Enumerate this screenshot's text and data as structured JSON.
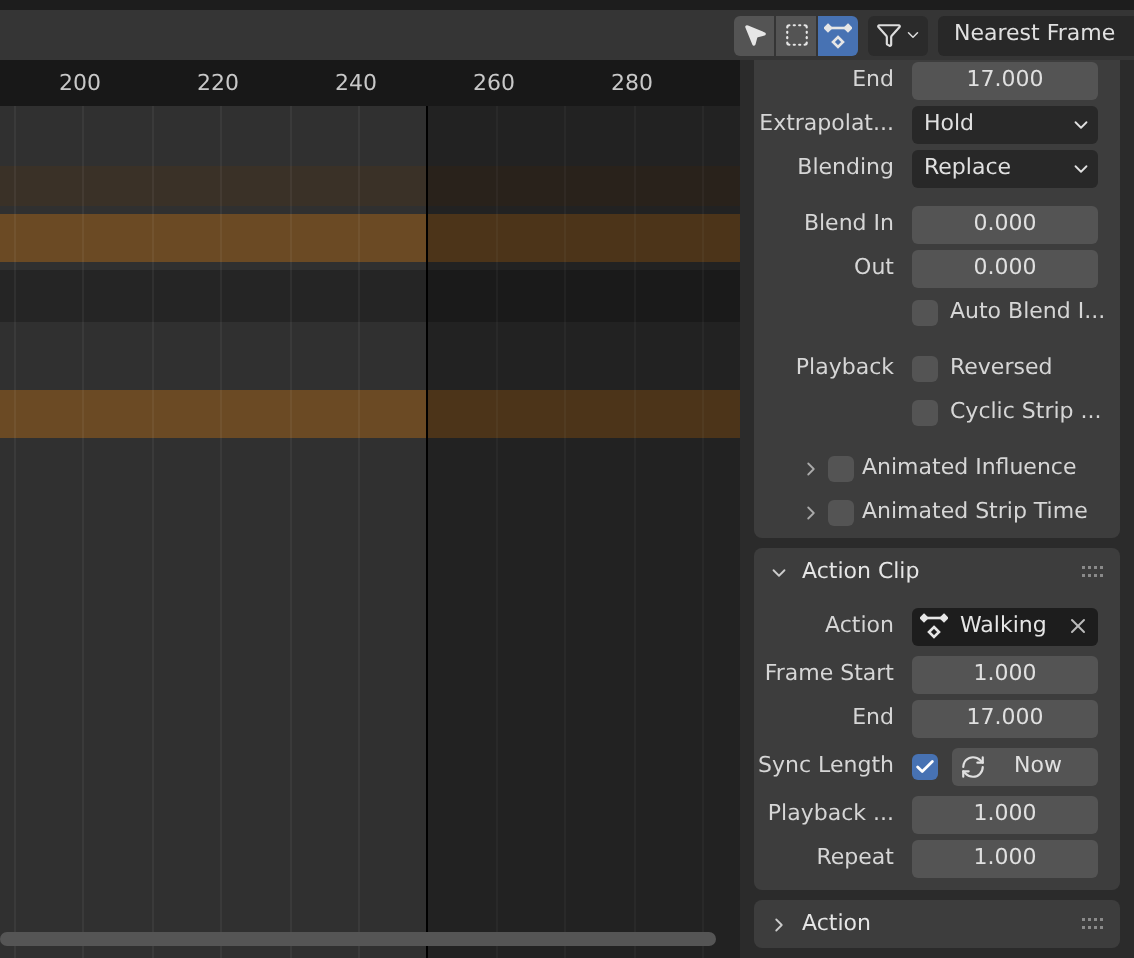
{
  "header": {
    "tools": [
      {
        "kind": "select",
        "selected": false
      },
      {
        "kind": "box",
        "selected": false
      },
      {
        "kind": "keyframe",
        "selected": true
      }
    ],
    "snap": "Nearest Frame"
  },
  "timeline": {
    "ruler": [
      "200",
      "220",
      "240",
      "260",
      "280"
    ],
    "tracks": [
      {
        "kind": "empty"
      },
      {
        "kind": "highlight"
      },
      {
        "kind": "strip"
      },
      {
        "kind": "dark"
      },
      {
        "kind": "empty"
      },
      {
        "kind": "strip"
      },
      {
        "kind": "empty"
      }
    ]
  },
  "strip_panel": {
    "groups": [
      [
        {
          "kind": "number",
          "label": "End",
          "value": "17.000"
        },
        {
          "kind": "dropdown",
          "label": "Extrapolat...",
          "value": "Hold"
        },
        {
          "kind": "dropdown",
          "label": "Blending",
          "value": "Replace"
        }
      ],
      [
        {
          "kind": "number",
          "label": "Blend In",
          "value": "0.000"
        },
        {
          "kind": "number",
          "label": "Out",
          "value": "0.000"
        },
        {
          "kind": "checkbox",
          "text": "Auto Blend I...",
          "checked": false
        }
      ],
      [
        {
          "kind": "checkbox",
          "label": "Playback",
          "text": "Reversed",
          "checked": false
        },
        {
          "kind": "checkbox",
          "text": "Cyclic Strip ...",
          "checked": false
        }
      ],
      [
        {
          "kind": "subpanel",
          "text": "Animated Influence",
          "expanded": false,
          "checked": false
        },
        {
          "kind": "subpanel",
          "text": "Animated Strip Time",
          "expanded": false,
          "checked": false
        }
      ]
    ]
  },
  "action_clip": {
    "title": "Action Clip",
    "expanded": true,
    "groups": [
      [
        {
          "kind": "action",
          "label": "Action",
          "value": "Walking"
        }
      ],
      [
        {
          "kind": "number",
          "label": "Frame Start",
          "value": "1.000"
        },
        {
          "kind": "number",
          "label": "End",
          "value": "17.000"
        }
      ],
      [
        {
          "kind": "sync",
          "label": "Sync Length",
          "checked": true,
          "button": "Now"
        }
      ],
      [
        {
          "kind": "number",
          "label": "Playback ...",
          "value": "1.000"
        },
        {
          "kind": "number",
          "label": "Repeat",
          "value": "1.000"
        }
      ]
    ]
  },
  "action_panel": {
    "title": "Action",
    "expanded": false
  }
}
